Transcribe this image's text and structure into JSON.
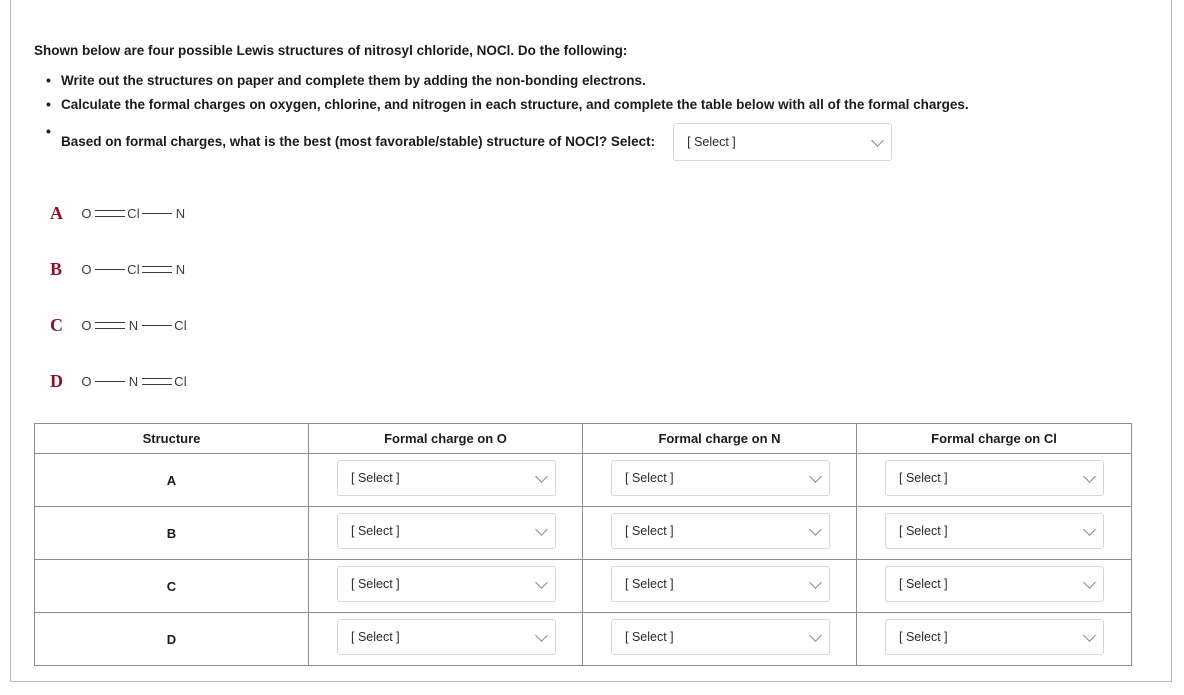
{
  "intro": "Shown below are four possible Lewis structures of nitrosyl chloride, NOCl. Do the following:",
  "bullets": [
    "Write out the structures on paper and complete them by adding the non-bonding electrons.",
    "Calculate the formal charges on oxygen, chlorine, and nitrogen in each structure, and complete the table below with all of the formal charges."
  ],
  "best_structure_question": {
    "text": "Based on formal charges, what is the best (most favorable/stable) structure of NOCl? Select:",
    "select_value": "[ Select ]"
  },
  "structures": [
    {
      "label": "A",
      "atoms": [
        "O",
        "Cl",
        "N"
      ],
      "bonds": [
        "double",
        "single"
      ],
      "notation": "O=Cl-N"
    },
    {
      "label": "B",
      "atoms": [
        "O",
        "Cl",
        "N"
      ],
      "bonds": [
        "single",
        "double"
      ],
      "notation": "O-Cl=N"
    },
    {
      "label": "C",
      "atoms": [
        "O",
        "N",
        "Cl"
      ],
      "bonds": [
        "double",
        "single"
      ],
      "notation": "O=N-Cl"
    },
    {
      "label": "D",
      "atoms": [
        "O",
        "N",
        "Cl"
      ],
      "bonds": [
        "single",
        "double"
      ],
      "notation": "O-N=Cl"
    }
  ],
  "table": {
    "headers": [
      "Structure",
      "Formal charge on O",
      "Formal charge on N",
      "Formal charge on Cl"
    ],
    "rows": [
      {
        "structure": "A",
        "charge_o": "[ Select ]",
        "charge_n": "[ Select ]",
        "charge_cl": "[ Select ]"
      },
      {
        "structure": "B",
        "charge_o": "[ Select ]",
        "charge_n": "[ Select ]",
        "charge_cl": "[ Select ]"
      },
      {
        "structure": "C",
        "charge_o": "[ Select ]",
        "charge_n": "[ Select ]",
        "charge_cl": "[ Select ]"
      },
      {
        "structure": "D",
        "charge_o": "[ Select ]",
        "charge_n": "[ Select ]",
        "charge_cl": "[ Select ]"
      }
    ]
  },
  "colors": {
    "structure_label": "#8f1229",
    "text": "#1b1b1b",
    "table_border": "#8d8d8d",
    "select_border": "#d7d7d7"
  }
}
